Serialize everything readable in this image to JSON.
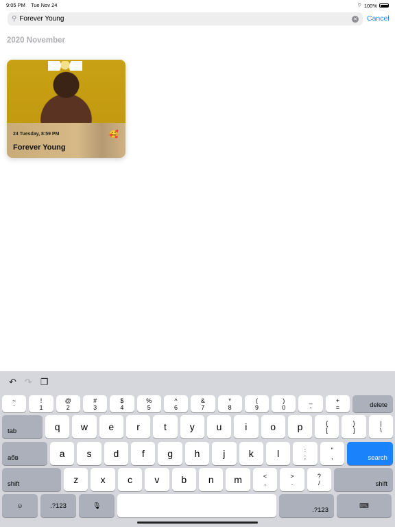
{
  "status": {
    "time": "9:05 PM",
    "date": "Tue Nov 24",
    "battery": "100%"
  },
  "search": {
    "value": "Forever Young",
    "cancel": "Cancel"
  },
  "section": "2020 November",
  "entries": [
    {
      "date": "24 Tuesday, 8:59 PM",
      "title": "Forever Young",
      "emoji": "🥰"
    }
  ],
  "keyboard": {
    "rows": [
      [
        [
          "~",
          "`"
        ],
        [
          "!",
          "1"
        ],
        [
          "@",
          "2"
        ],
        [
          "#",
          "3"
        ],
        [
          "$",
          "4"
        ],
        [
          "%",
          "5"
        ],
        [
          "^",
          "6"
        ],
        [
          "&",
          "7"
        ],
        [
          "*",
          "8"
        ],
        [
          "(",
          "9"
        ],
        [
          ")",
          "0"
        ],
        [
          "_",
          "-"
        ],
        [
          "+",
          "="
        ],
        "delete"
      ],
      [
        "tab",
        "q",
        "w",
        "e",
        "r",
        "t",
        "y",
        "u",
        "i",
        "o",
        "p",
        [
          "{",
          "["
        ],
        [
          "}",
          "]"
        ],
        [
          "|",
          "\\"
        ]
      ],
      [
        "абв",
        "a",
        "s",
        "d",
        "f",
        "g",
        "h",
        "j",
        "k",
        "l",
        [
          ":",
          ";"
        ],
        [
          "\"",
          ","
        ],
        "search"
      ],
      [
        "shift",
        "z",
        "x",
        "c",
        "v",
        "b",
        "n",
        "m",
        [
          "<",
          ","
        ],
        [
          ">",
          "."
        ],
        [
          "?",
          "/"
        ],
        "shift"
      ],
      [
        "☺",
        ".?123",
        "🎙",
        " ",
        ".?123",
        "⌨"
      ]
    ],
    "accent": "#1a82fb"
  }
}
